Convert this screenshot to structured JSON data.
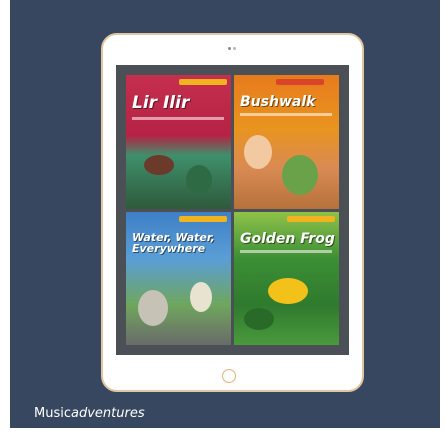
{
  "brand": {
    "prefix": "Music",
    "suffix": "adventures"
  },
  "books": [
    {
      "title": "Lir Ilir"
    },
    {
      "title": "Bushwalk"
    },
    {
      "title": "Water, Water, Everywhere"
    },
    {
      "title": "Golden Frog"
    }
  ]
}
